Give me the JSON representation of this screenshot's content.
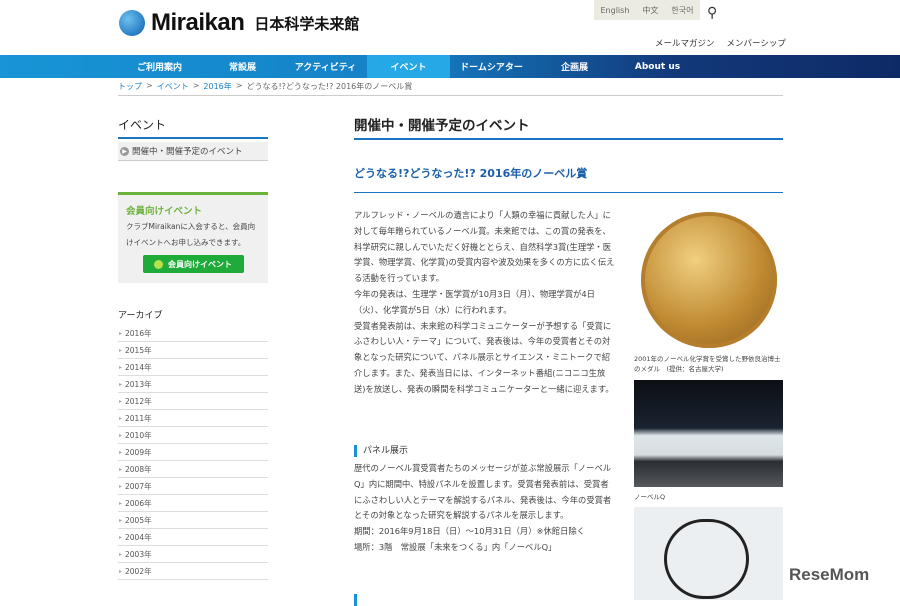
{
  "header": {
    "logo_en": "Miraikan",
    "logo_ja": "日本科学未来館",
    "languages": [
      "English",
      "中文",
      "한국어"
    ],
    "links": [
      "メールマガジン",
      "メンバーシップ"
    ]
  },
  "nav": [
    "ご利用案内",
    "常設展",
    "アクティビティ",
    "イベント",
    "ドームシアター",
    "企画展",
    "About us"
  ],
  "breadcrumb": [
    "トップ",
    "イベント",
    "2016年",
    "どうなる!?どうなった!? 2016年のノーベル賞"
  ],
  "sidebar": {
    "heading": "イベント",
    "item": "開催中・開催予定のイベント",
    "member": {
      "title": "会員向けイベント",
      "desc": "クラブMiraikanに入会すると、会員向けイベントへお申し込みできます。",
      "button": "会員向けイベント"
    },
    "archive_heading": "アーカイブ",
    "years": [
      "2016年",
      "2015年",
      "2014年",
      "2013年",
      "2012年",
      "2011年",
      "2010年",
      "2009年",
      "2008年",
      "2007年",
      "2006年",
      "2005年",
      "2004年",
      "2003年",
      "2002年"
    ]
  },
  "main": {
    "title": "開催中・開催予定のイベント",
    "subtitle": "どうなる!?どうなった!? 2016年のノーベル賞",
    "p1": "アルフレッド・ノーベルの遺言により「人類の幸福に貢献した人」に対して毎年贈られているノーベル賞。未来館では、この賞の発表を、科学研究に親しんでいただく好機ととらえ、自然科学3賞(生理学・医学賞、物理学賞、化学賞)の受賞内容や波及効果を多くの方に広く伝える活動を行っています。",
    "p2": "今年の発表は、生理学・医学賞が10月3日（月）、物理学賞が4日（火）、化学賞が5日（水）に行われます。",
    "p3": "受賞者発表前は、未来館の科学コミュニケーターが予想する「受賞にふさわしい人・テーマ」について、発表後は、今年の受賞者とその対象となった研究について、パネル展示とサイエンス・ミニトークで紹介します。また、発表当日には、インターネット番組(ニコニコ生放送)を放送し、発表の瞬間を科学コミュニケーターと一緒に迎えます。",
    "panel_heading": "パネル展示",
    "panel_text": "歴代のノーベル賞受賞者たちのメッセージが並ぶ常設展示「ノーベルQ」内に期間中、特設パネルを設置します。受賞者発表前は、受賞者にふさわしい人とテーマを解説するパネル、発表後は、今年の受賞者とその対象となった研究を解説するパネルを展示します。",
    "panel_period": "期間：2016年9月18日（日）～10月31日（月）※休館日除く",
    "panel_place": "場所：3階　常設展「未来をつくる」内「ノーベルQ」",
    "caption1": "2001年のノーベル化学賞を受賞した野依良治博士のメダル　(提供：名古屋大学)",
    "caption2": "ノーベルQ"
  },
  "watermark": "ReseMom"
}
